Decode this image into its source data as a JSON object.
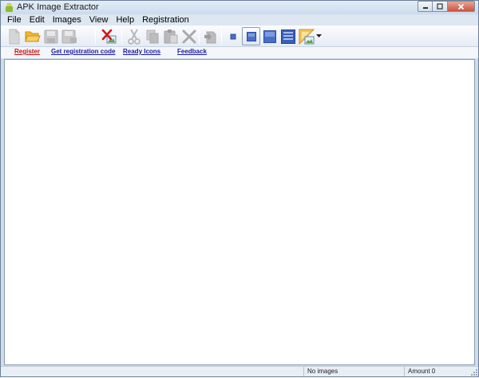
{
  "window": {
    "title": "APK Image Extractor"
  },
  "menu": {
    "items": [
      "File",
      "Edit",
      "Images",
      "View",
      "Help",
      "Registration"
    ]
  },
  "toolbar": {
    "buttons": [
      {
        "icon": "new-icon"
      },
      {
        "icon": "open-folder-icon"
      },
      {
        "icon": "save-icon"
      },
      {
        "icon": "save-as-icon"
      },
      {
        "icon": "delete-image-icon"
      },
      {
        "icon": "cut-icon"
      },
      {
        "icon": "copy-icon"
      },
      {
        "icon": "paste-icon"
      },
      {
        "icon": "delete-icon"
      },
      {
        "icon": "duplicate-icon"
      },
      {
        "icon": "small-icons-view-icon"
      },
      {
        "icon": "medium-icons-view-icon",
        "active": true
      },
      {
        "icon": "large-icons-view-icon"
      },
      {
        "icon": "list-view-icon"
      },
      {
        "icon": "background-icon"
      }
    ]
  },
  "links": {
    "register": "Register",
    "get_code": "Get registration code",
    "ready_icons": "Ready Icons",
    "feedback": "Feedback"
  },
  "status": {
    "images_text": "No images",
    "amount_text": "Amount 0"
  },
  "colors": {
    "register_link": "#cc1111",
    "link": "#1a1aa8",
    "window_frame": "#cfdceb"
  }
}
